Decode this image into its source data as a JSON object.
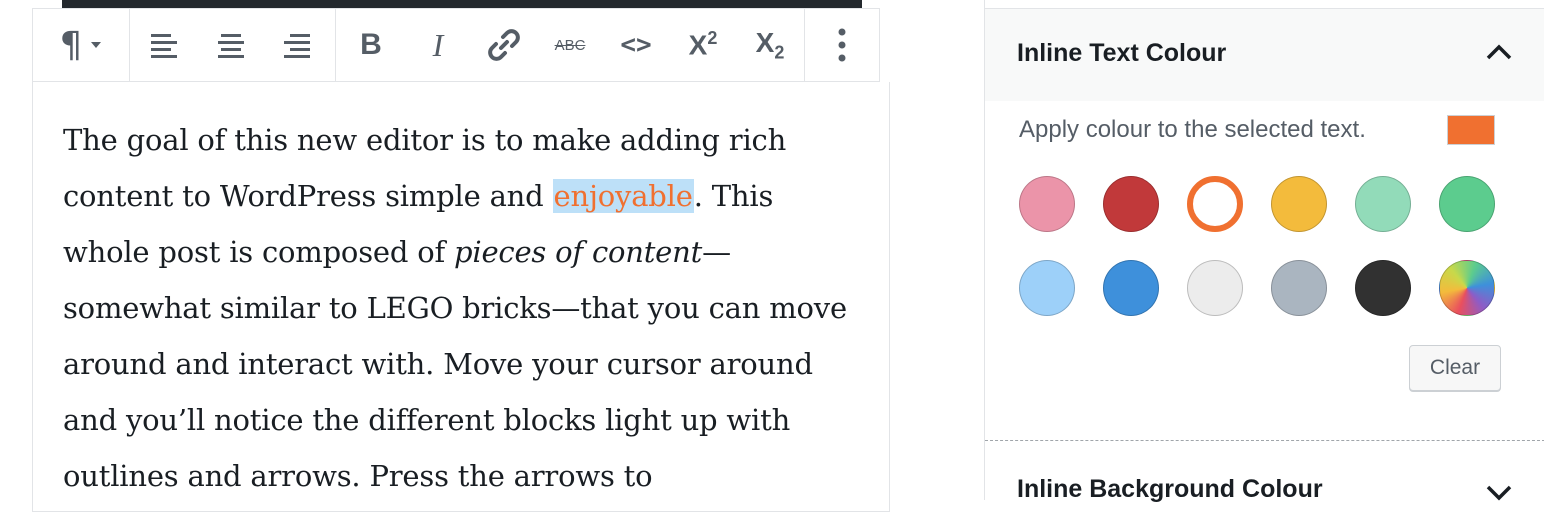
{
  "toolbar": {
    "paragraph_label": "¶",
    "bold_label": "B",
    "italic_label": "I",
    "strike_label": "ABC",
    "code_label": "<>",
    "superscript": {
      "base": "X",
      "mark": "2"
    },
    "subscript": {
      "base": "X",
      "mark": "2"
    }
  },
  "editor": {
    "text_before": "The goal of this new editor is to make adding rich content to WordPress simple and ",
    "colored_word": "enjoyable",
    "text_mid": ". This whole post is composed of ",
    "italic_text": "pieces of content",
    "text_after": "—somewhat similar to LEGO bricks—that you can move around and interact with. Move your cursor around and you’ll notice the different blocks light up with outlines and arrows. Press the arrows to"
  },
  "sidebar": {
    "panel_title": "Inline Text Colour",
    "apply_text": "Apply colour to the selected text.",
    "current_color": "#f07030",
    "palette": [
      {
        "name": "pale-pink",
        "color": "#eb94a9",
        "selected": false
      },
      {
        "name": "vivid-red",
        "color": "#c1393a",
        "selected": false
      },
      {
        "name": "luminous-orange",
        "color": "#f07030",
        "selected": true
      },
      {
        "name": "amber",
        "color": "#f3bb3c",
        "selected": false
      },
      {
        "name": "light-green",
        "color": "#92dbb9",
        "selected": false
      },
      {
        "name": "green",
        "color": "#5ccc8e",
        "selected": false
      },
      {
        "name": "pale-blue",
        "color": "#9dd0f9",
        "selected": false
      },
      {
        "name": "blue",
        "color": "#3e90db",
        "selected": false
      },
      {
        "name": "light-gray",
        "color": "#ececec",
        "selected": false
      },
      {
        "name": "cyan-gray",
        "color": "#aab5c0",
        "selected": false
      },
      {
        "name": "black",
        "color": "#313131",
        "selected": false
      },
      {
        "name": "custom-gradient",
        "color": "gradient",
        "selected": false
      }
    ],
    "clear_label": "Clear",
    "panel2_title": "Inline Background Colour"
  }
}
